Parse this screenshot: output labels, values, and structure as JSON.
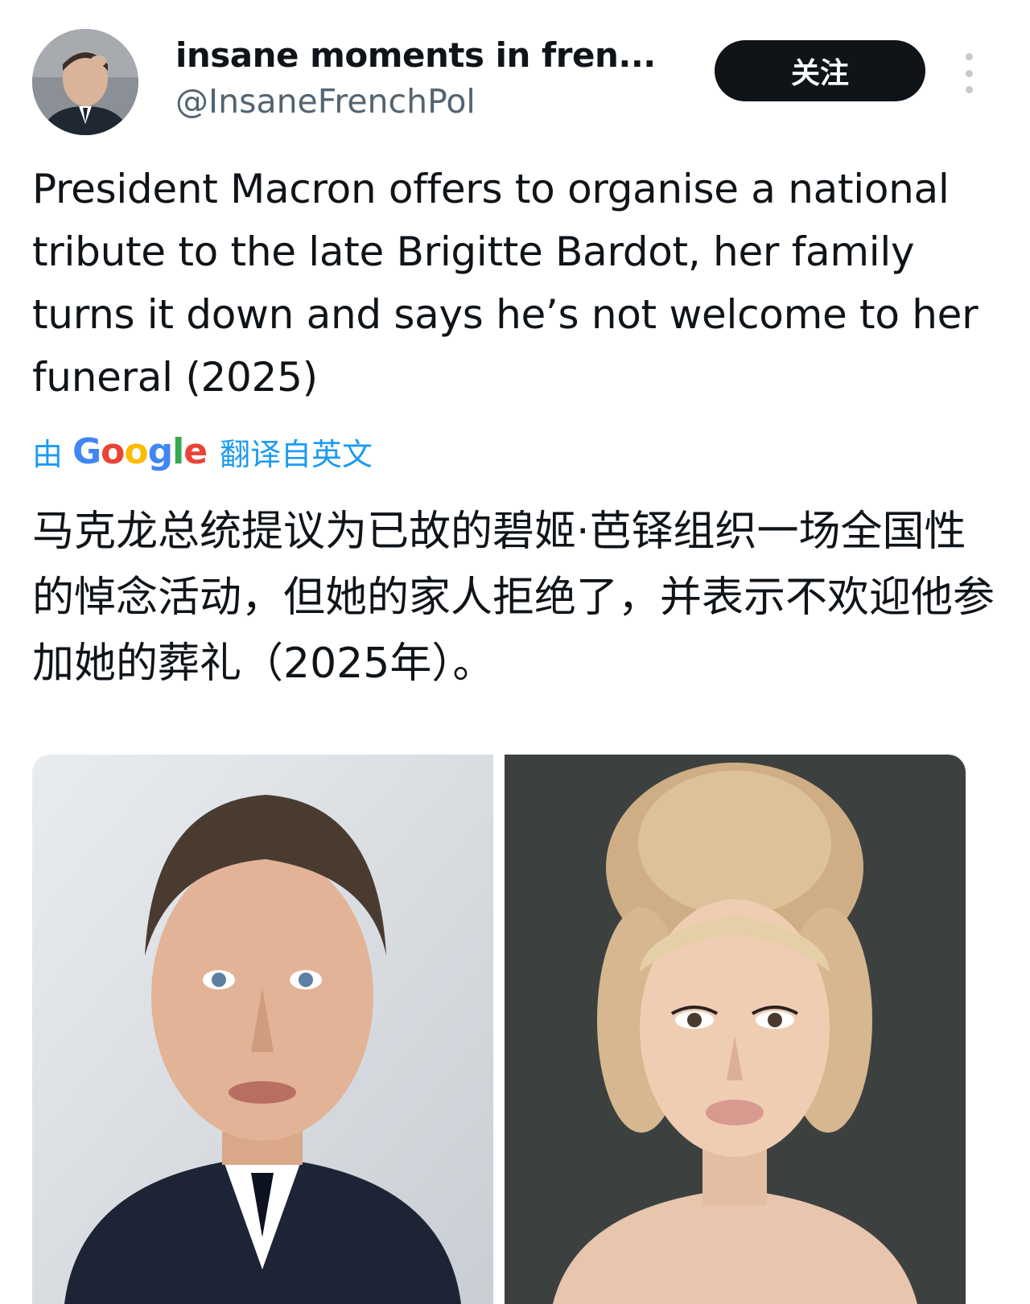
{
  "author": {
    "display_name": "insane moments in fren...",
    "handle": "@InsaneFrenchPol",
    "avatar_icon": "avatar-photo"
  },
  "actions": {
    "follow_label": "关注",
    "more_icon": "more-vertical-icon"
  },
  "tweet": {
    "text_en": "President Macron offers to organise a national tribute to the late Brigitte Bardot, her family turns it down and says he’s not welcome to her funeral (2025)",
    "translation": {
      "by": "由",
      "provider": "Google",
      "suffix": "翻译自英文"
    },
    "text_zh": "马克龙总统提议为已故的碧姬·芭铎组织一场全国性的悼念活动，但她的家人拒绝了，并表示不欢迎他参加她的葬礼（2025年）。"
  },
  "media": [
    {
      "alt": "Photo of a man in a dark suit and tie"
    },
    {
      "alt": "Photo of a woman with a blonde updo hairstyle"
    }
  ],
  "colors": {
    "text": "#0f1419",
    "secondary": "#536471",
    "link": "#1d9bf0",
    "button_bg": "#0f1419"
  }
}
